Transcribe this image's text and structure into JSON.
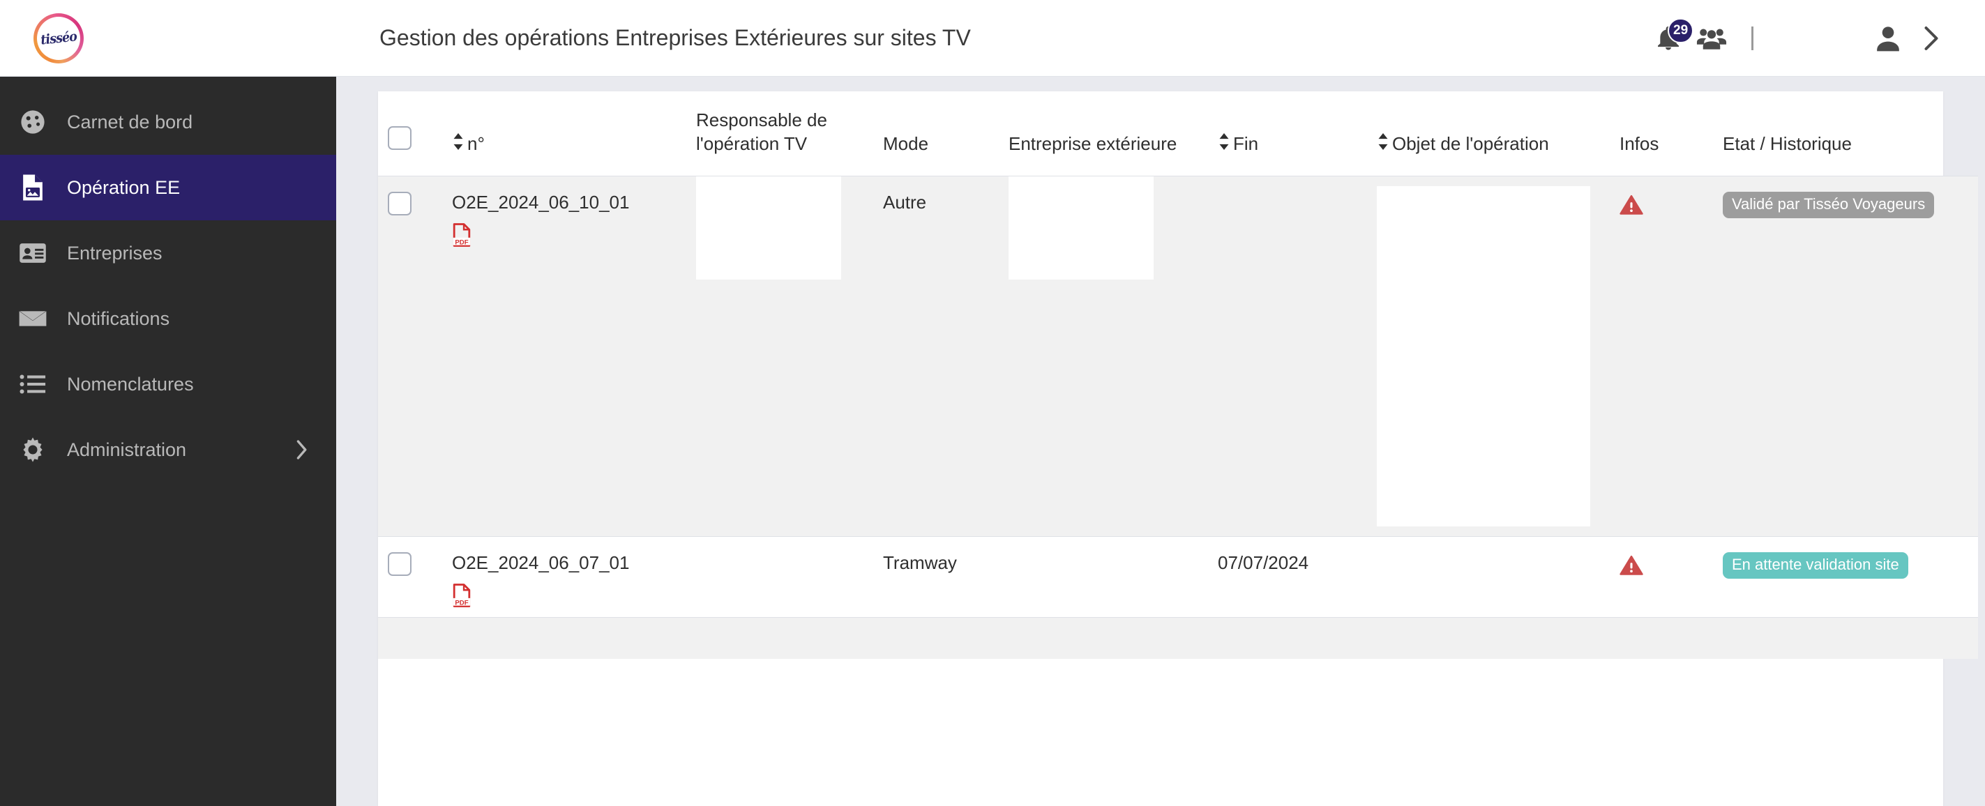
{
  "header": {
    "logo_text": "tisséo",
    "logo_name": "tisseo-logo",
    "title": "Gestion des opérations Entreprises Extérieures sur sites TV",
    "notification_count": "29",
    "icons": [
      "bell-icon",
      "people-icon",
      "user-icon",
      "chevron-right-icon"
    ]
  },
  "sidebar": {
    "items": [
      {
        "label": "Carnet de bord",
        "icon": "dashboard-icon",
        "active": false,
        "has_chevron": false
      },
      {
        "label": "Opération EE",
        "icon": "document-image-icon",
        "active": true,
        "has_chevron": false
      },
      {
        "label": "Entreprises",
        "icon": "id-card-icon",
        "active": false,
        "has_chevron": false
      },
      {
        "label": "Notifications",
        "icon": "envelope-icon",
        "active": false,
        "has_chevron": false
      },
      {
        "label": "Nomenclatures",
        "icon": "list-icon",
        "active": false,
        "has_chevron": false
      },
      {
        "label": "Administration",
        "icon": "gear-icon",
        "active": false,
        "has_chevron": true
      }
    ]
  },
  "table": {
    "columns": [
      {
        "key": "checkbox",
        "label": "",
        "sortable": false
      },
      {
        "key": "num",
        "label": "n°",
        "sortable": true
      },
      {
        "key": "responsable",
        "label": "Responsable de l'opération TV",
        "sortable": false
      },
      {
        "key": "mode",
        "label": "Mode",
        "sortable": false
      },
      {
        "key": "entreprise",
        "label": "Entreprise extérieure",
        "sortable": false
      },
      {
        "key": "fin",
        "label": "Fin",
        "sortable": true
      },
      {
        "key": "objet",
        "label": "Objet de l'opération",
        "sortable": true
      },
      {
        "key": "infos",
        "label": "Infos",
        "sortable": false
      },
      {
        "key": "etat",
        "label": "Etat / Historique",
        "sortable": false
      }
    ],
    "rows": [
      {
        "num": "O2E_2024_06_10_01",
        "attachment": "pdf-icon",
        "responsable": "",
        "mode": "Autre",
        "entreprise": "",
        "fin": "",
        "objet": "",
        "infos": "warning-icon",
        "etat": "Validé par Tisséo Voyageurs",
        "etat_style": "grey"
      },
      {
        "num": "O2E_2024_06_07_01",
        "attachment": "pdf-icon",
        "responsable": "",
        "mode": "Tramway",
        "entreprise": "",
        "fin": "07/07/2024",
        "objet": "",
        "infos": "warning-icon",
        "etat": "En attente validation site",
        "etat_style": "teal"
      }
    ]
  },
  "colors": {
    "sidebar_bg": "#2b2b2b",
    "sidebar_active": "#2b2069",
    "page_bg": "#e9eaef",
    "badge_grey": "#9d9d9d",
    "badge_teal": "#66c6c1",
    "warning_red": "#cb4b4b",
    "pdf_red": "#d32f2f"
  }
}
